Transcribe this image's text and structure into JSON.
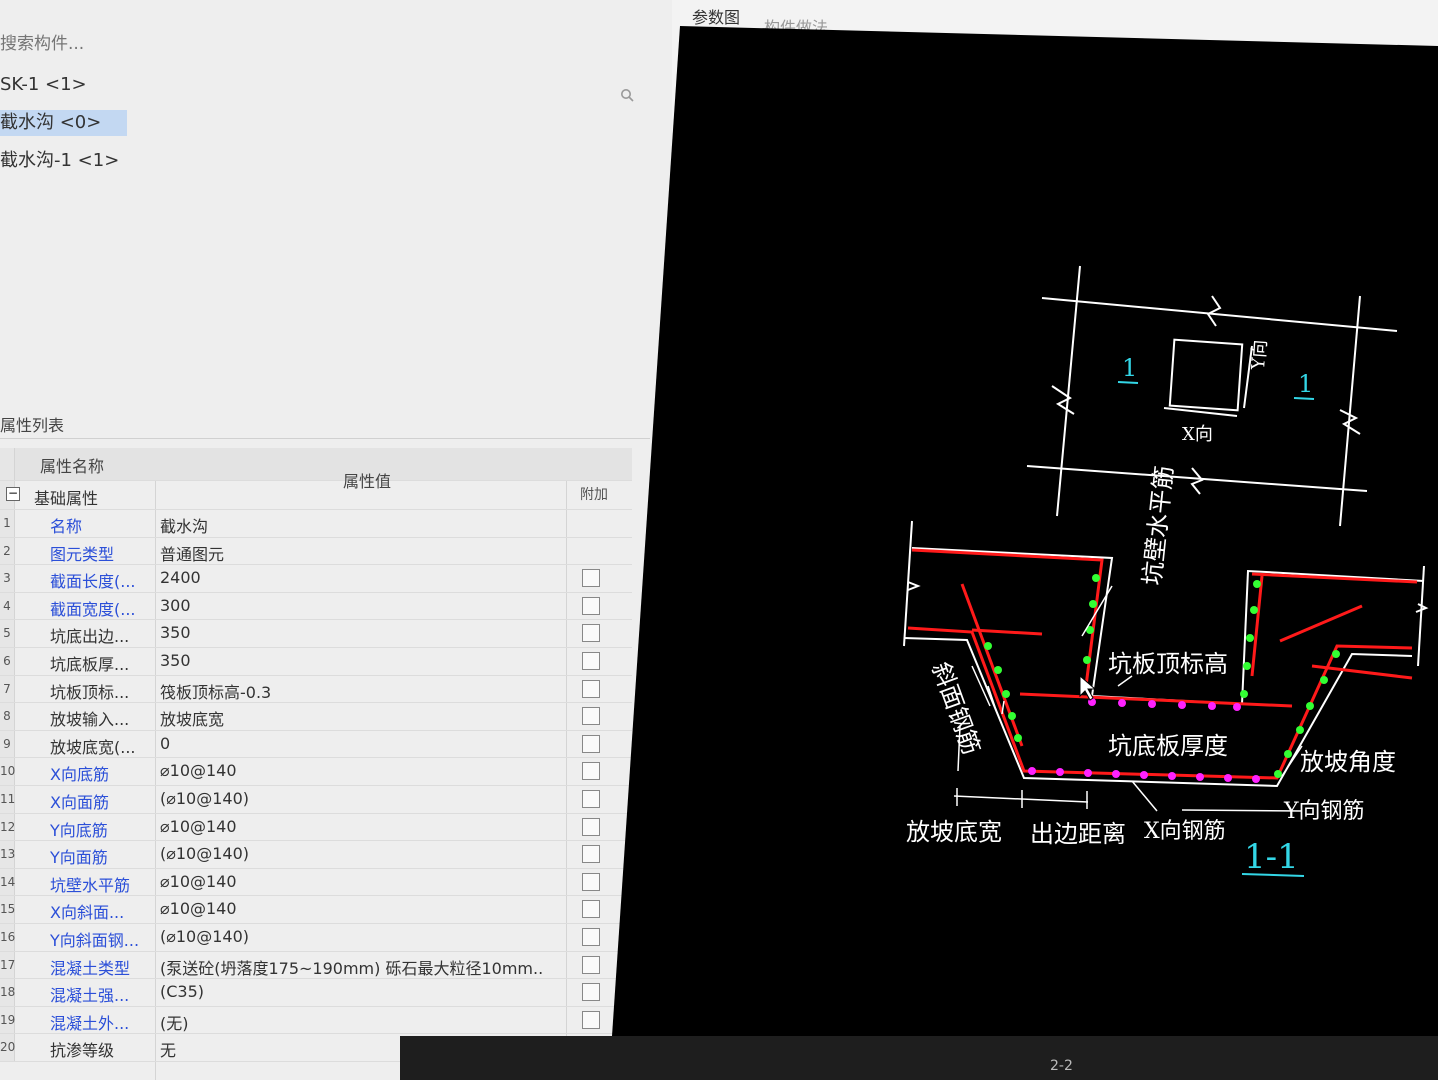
{
  "search": {
    "placeholder": "搜索构件..."
  },
  "tree": {
    "items": [
      {
        "label": "SK-1 <1>"
      },
      {
        "label": "截水沟 <0>"
      },
      {
        "label": "截水沟-1 <1>"
      }
    ]
  },
  "properties": {
    "header": "属性列表",
    "col_name": "属性名称",
    "col_value": "属性值",
    "col_extra": "附加",
    "group": "基础属性",
    "rows": [
      {
        "idx": "1",
        "name": "名称",
        "value": "截水沟"
      },
      {
        "idx": "2",
        "name": "图元类型",
        "value": "普通图元"
      },
      {
        "idx": "3",
        "name": "截面长度(...",
        "value": "2400"
      },
      {
        "idx": "4",
        "name": "截面宽度(...",
        "value": "300"
      },
      {
        "idx": "5",
        "name": "坑底出边...",
        "value": "350"
      },
      {
        "idx": "6",
        "name": "坑底板厚...",
        "value": "350"
      },
      {
        "idx": "7",
        "name": "坑板顶标...",
        "value": "筏板顶标高-0.3"
      },
      {
        "idx": "8",
        "name": "放坡输入...",
        "value": "放坡底宽"
      },
      {
        "idx": "9",
        "name": "放坡底宽(...",
        "value": "0"
      },
      {
        "idx": "10",
        "name": "X向底筋",
        "value": "⌀10@140"
      },
      {
        "idx": "11",
        "name": "X向面筋",
        "value": "(⌀10@140)"
      },
      {
        "idx": "12",
        "name": "Y向底筋",
        "value": "⌀10@140"
      },
      {
        "idx": "13",
        "name": "Y向面筋",
        "value": "(⌀10@140)"
      },
      {
        "idx": "14",
        "name": "坑壁水平筋",
        "value": "⌀10@140"
      },
      {
        "idx": "15",
        "name": "X向斜面...",
        "value": "⌀10@140"
      },
      {
        "idx": "16",
        "name": "Y向斜面钢...",
        "value": "(⌀10@140)"
      },
      {
        "idx": "17",
        "name": "混凝土类型",
        "value": "(泵送砼(坍落度175~190mm) 砾石最大粒径10mm..."
      },
      {
        "idx": "18",
        "name": "混凝土强...",
        "value": "(C35)"
      },
      {
        "idx": "19",
        "name": "混凝土外...",
        "value": "(无)"
      },
      {
        "idx": "20",
        "name": "抗渗等级",
        "value": "无"
      }
    ]
  },
  "right_tabs": [
    {
      "label": "参数图"
    },
    {
      "label": "构件做法"
    }
  ],
  "drawing": {
    "section_mark_left": "1",
    "section_mark_right": "1",
    "label_y_dir": "Y向",
    "label_x_dir": "X向",
    "label_wall_horizontal_bar": "坑壁水平筋",
    "label_top_elevation": "坑板顶标高",
    "label_slope_bar": "斜面钢筋",
    "label_bottom_thickness": "坑底板厚度",
    "label_slope_angle": "放坡角度",
    "label_y_bar": "Y向钢筋",
    "label_slope_width": "放坡底宽",
    "label_edge_distance": "出边距离",
    "label_x_bar": "X向钢筋",
    "section_title": "1-1",
    "colors": {
      "background": "#000000",
      "lines": "#ffffff",
      "rebar_main": "#ff1a1a",
      "dots_wall": "#33ff33",
      "dots_bottom": "#ff22ff",
      "section_label": "#33d6e6"
    }
  },
  "statusbar": {
    "tag": "2-2"
  }
}
